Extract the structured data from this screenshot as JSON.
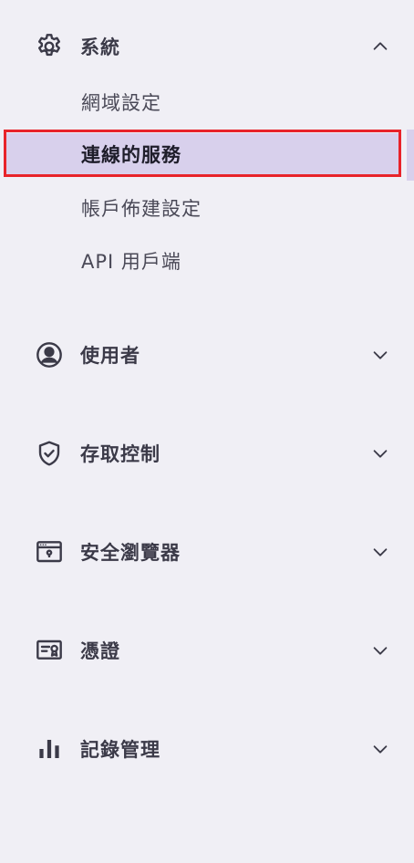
{
  "sidebar": {
    "system": {
      "label": "系統",
      "icon": "gear-icon",
      "expanded": true,
      "items": [
        {
          "label": "網域設定"
        },
        {
          "label": "連線的服務",
          "active": true
        },
        {
          "label": "帳戶佈建設定"
        },
        {
          "label": "API 用戶端"
        }
      ]
    },
    "users": {
      "label": "使用者",
      "icon": "user-circle-icon"
    },
    "access_control": {
      "label": "存取控制",
      "icon": "shield-check-icon"
    },
    "secure_browser": {
      "label": "安全瀏覽器",
      "icon": "browser-window-icon"
    },
    "credentials": {
      "label": "憑證",
      "icon": "certificate-icon"
    },
    "log_management": {
      "label": "記錄管理",
      "icon": "bar-chart-icon"
    }
  },
  "colors": {
    "background": "#f0eff5",
    "active_background": "#d8d0ec",
    "highlight_outline": "#e8232a",
    "text": "#3b3a48"
  }
}
